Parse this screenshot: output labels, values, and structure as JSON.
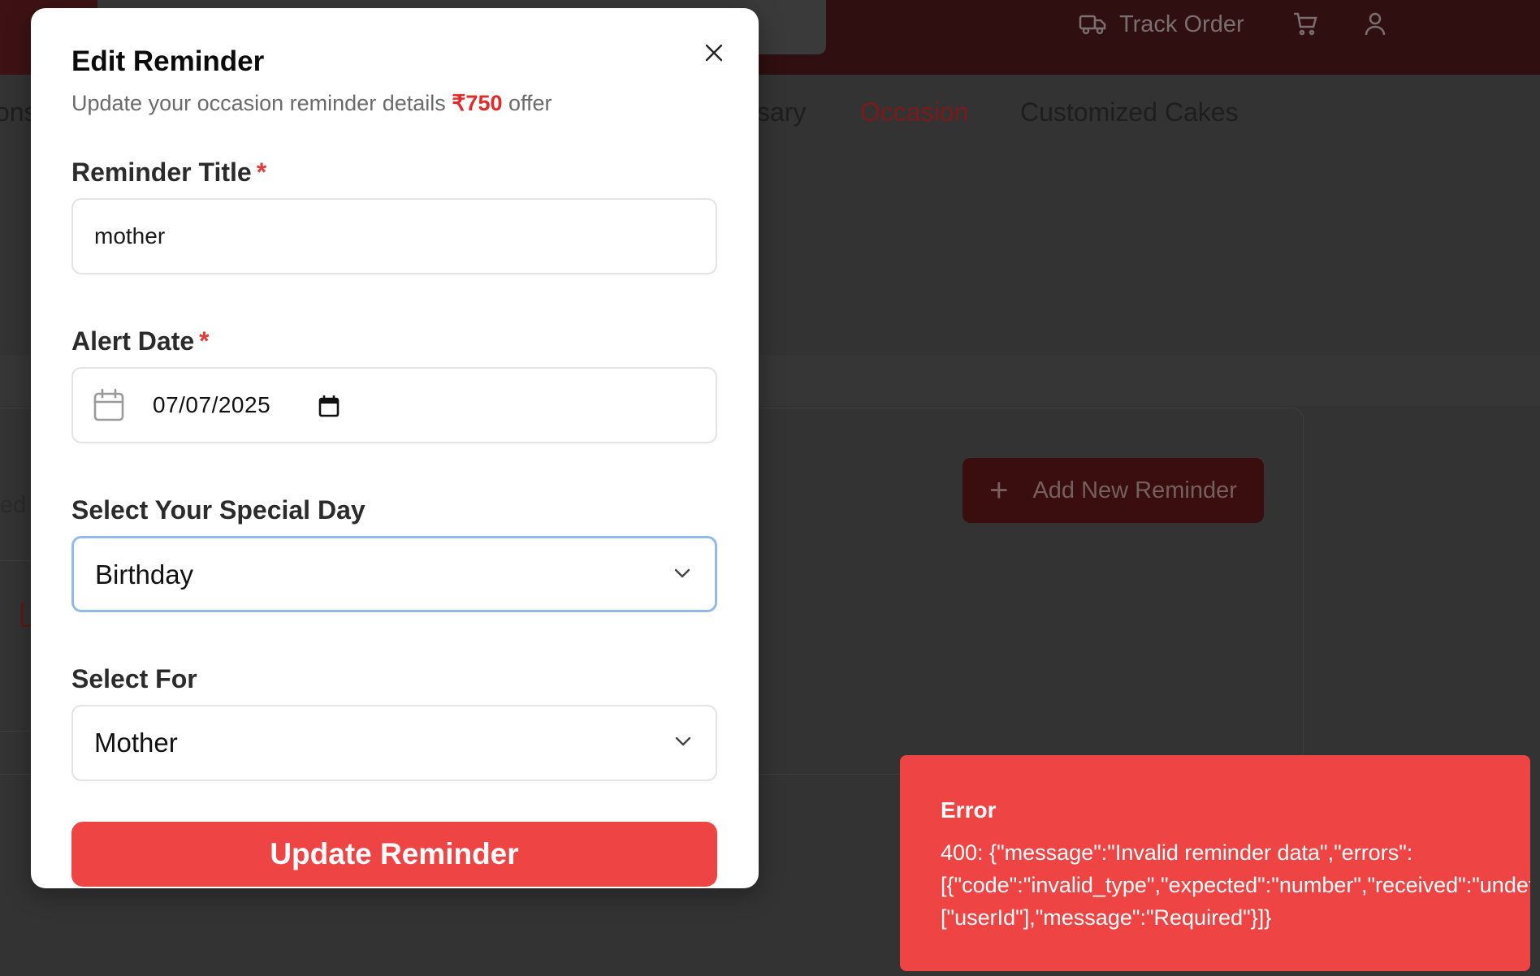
{
  "header": {
    "track_order_label": "Track Order",
    "icons": [
      "truck-icon",
      "cart-icon",
      "user-icon"
    ]
  },
  "nav": {
    "items": [
      {
        "label": "ons",
        "active": false
      },
      {
        "label": "sary",
        "active": false
      },
      {
        "label": "Occasion",
        "active": true
      },
      {
        "label": "Customized Cakes",
        "active": false
      }
    ]
  },
  "background": {
    "side_text": "ed",
    "add_reminder_label": "Add New Reminder"
  },
  "modal": {
    "title": "Edit Reminder",
    "subtitle_prefix": "Update your occasion reminder details ",
    "subtitle_amount": "₹750",
    "subtitle_suffix": " offer",
    "fields": {
      "reminder_title": {
        "label": "Reminder Title",
        "required_mark": "*",
        "value": "mother"
      },
      "alert_date": {
        "label": "Alert Date",
        "required_mark": "*",
        "value": "07/07/2025"
      },
      "special_day": {
        "label": "Select Your Special Day",
        "value": "Birthday"
      },
      "select_for": {
        "label": "Select For",
        "value": "Mother"
      }
    },
    "submit_label": "Update Reminder"
  },
  "toast": {
    "title": "Error",
    "lines": [
      "400: {\"message\":\"Invalid reminder data\",\"errors\":",
      "[{\"code\":\"invalid_type\",\"expected\":\"number\",\"received\":\"undefined\",\"path\":",
      "[\"userId\"],\"message\":\"Required\"}]}"
    ]
  },
  "colors": {
    "accent": "#ef4444",
    "required": "#e23b3b",
    "focus_ring": "#93b9ea",
    "topbar": "#2f0f10"
  }
}
